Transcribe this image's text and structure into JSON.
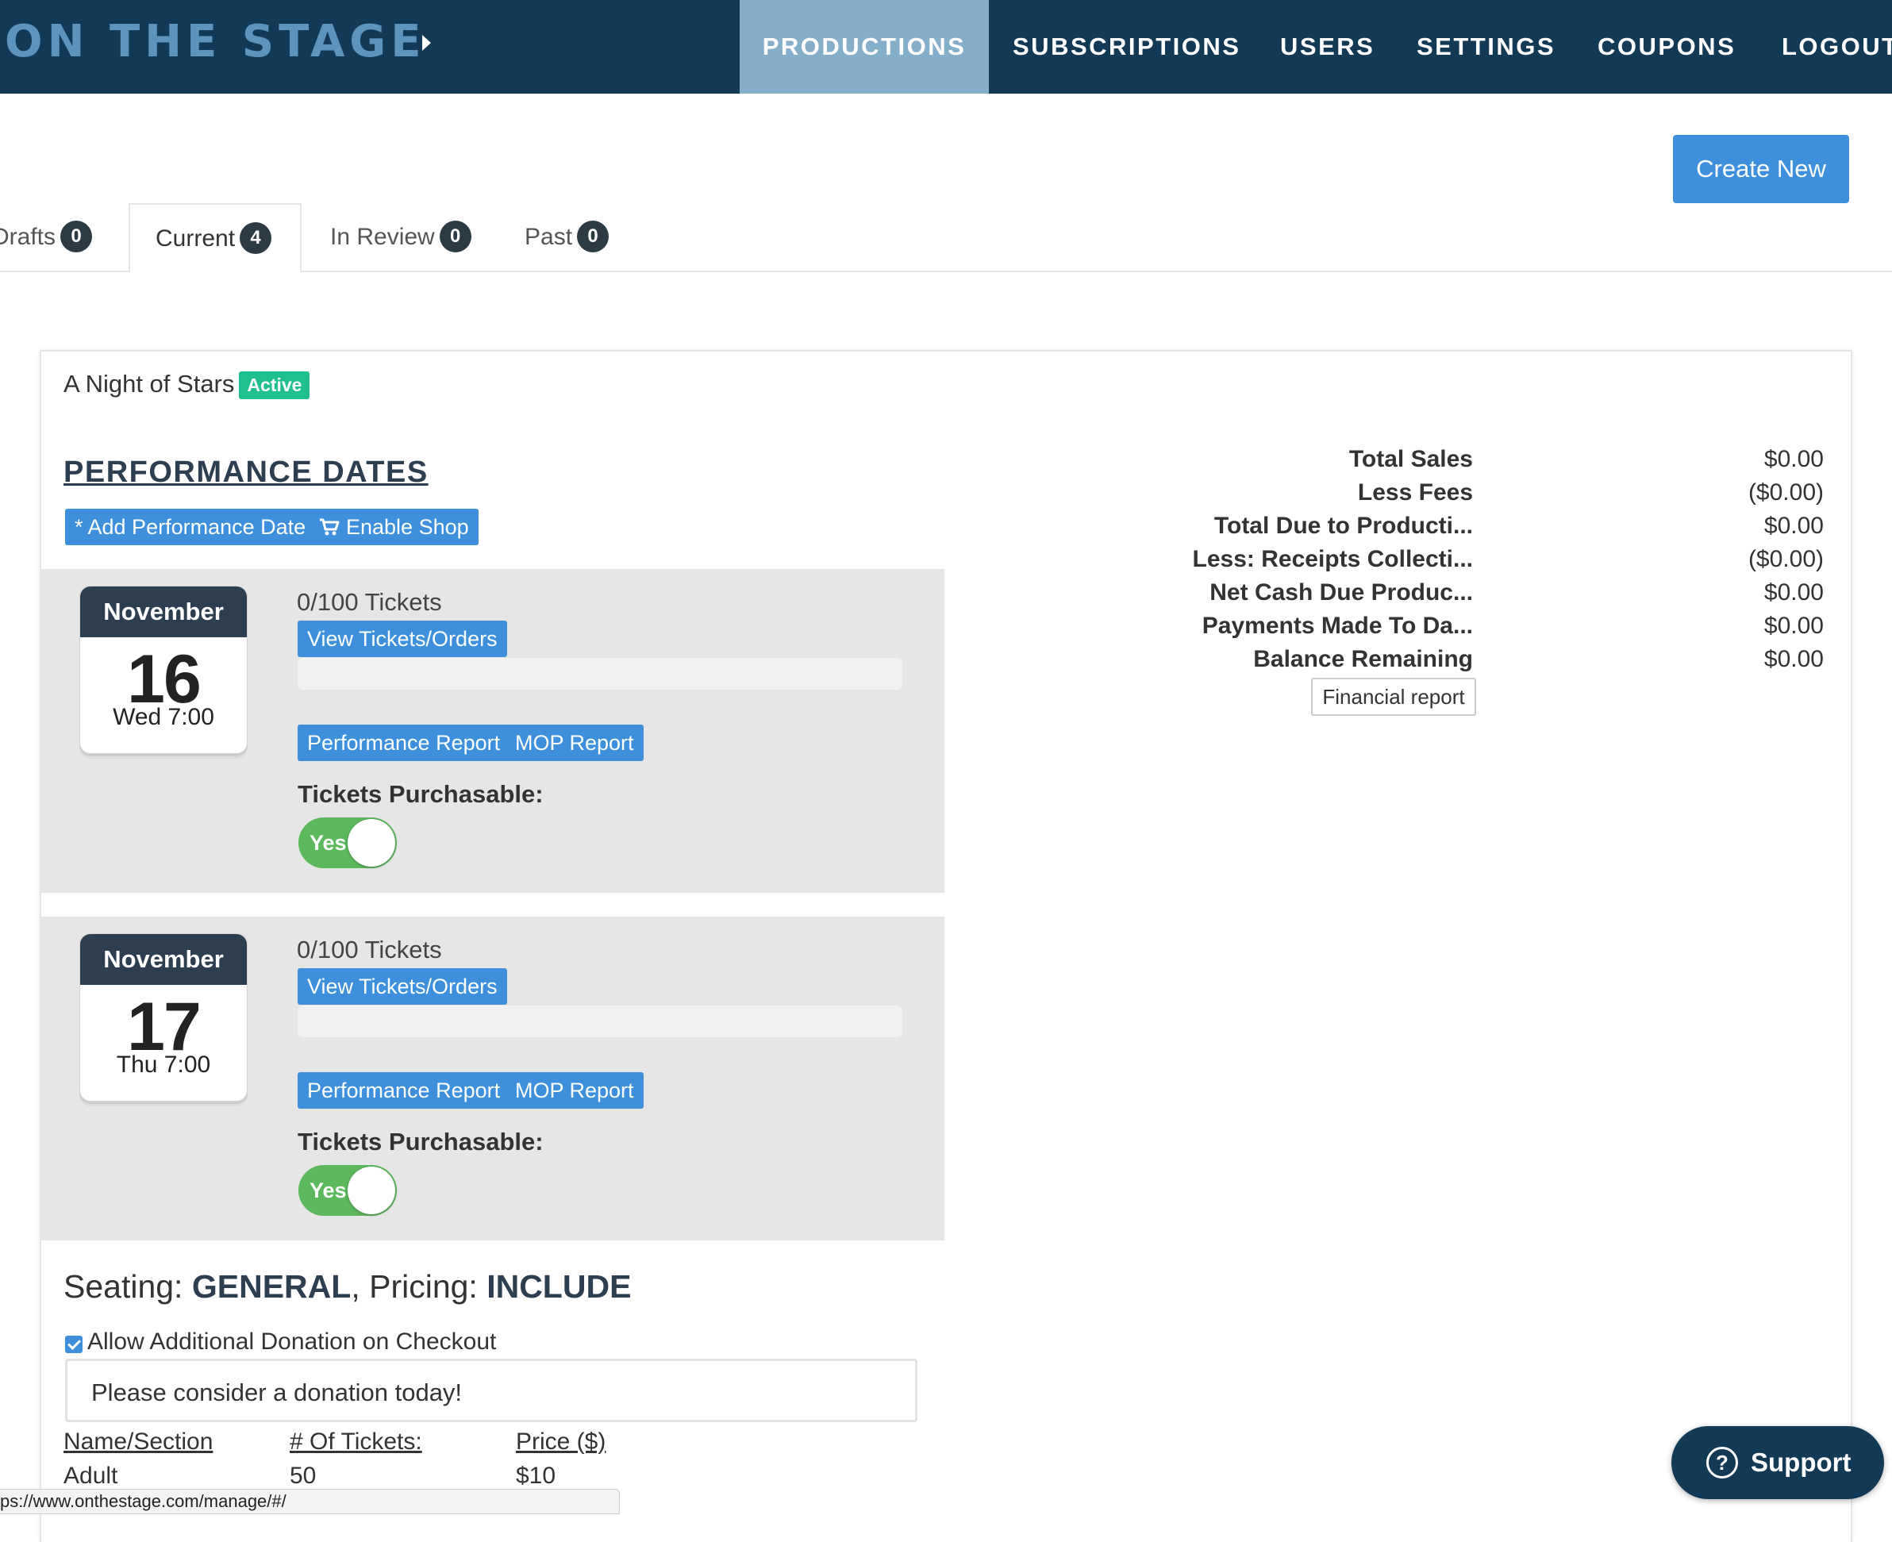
{
  "brand": {
    "name": "ON THE STAGE"
  },
  "nav": {
    "items": [
      {
        "label": "PRODUCTIONS",
        "active": true
      },
      {
        "label": "SUBSCRIPTIONS",
        "active": false
      },
      {
        "label": "USERS",
        "active": false
      },
      {
        "label": "SETTINGS",
        "active": false
      },
      {
        "label": "COUPONS",
        "active": false
      },
      {
        "label": "LOGOUT",
        "active": false
      }
    ]
  },
  "create_button": "Create New",
  "tabs": [
    {
      "label": "Drafts",
      "count": "0"
    },
    {
      "label": "Current",
      "count": "4",
      "active": true
    },
    {
      "label": "In Review",
      "count": "0"
    },
    {
      "label": "Past",
      "count": "0"
    }
  ],
  "production": {
    "title": "A Night of Stars",
    "status": "Active",
    "performance_heading": "PERFORMANCE DATES",
    "add_date_label": "* Add Performance Date",
    "enable_shop_label": "Enable Shop",
    "performances": [
      {
        "month": "November",
        "day": "16",
        "time": "Wed 7:00",
        "tickets": "0/100 Tickets",
        "sold_fraction": 0,
        "view_label": "View Tickets/Orders",
        "perf_report_label": "Performance Report",
        "mop_report_label": "MOP Report",
        "purchasable_label": "Tickets Purchasable:",
        "toggle_label": "Yes"
      },
      {
        "month": "November",
        "day": "17",
        "time": "Thu 7:00",
        "tickets": "0/100 Tickets",
        "sold_fraction": 0,
        "view_label": "View Tickets/Orders",
        "perf_report_label": "Performance Report",
        "mop_report_label": "MOP Report",
        "purchasable_label": "Tickets Purchasable:",
        "toggle_label": "Yes"
      }
    ],
    "financials": [
      {
        "label": "Total Sales",
        "value": "$0.00"
      },
      {
        "label": "Less Fees",
        "value": "($0.00)"
      },
      {
        "label": "Total Due to Producti...",
        "value": "$0.00"
      },
      {
        "label": "Less: Receipts Collecti...",
        "value": "($0.00)"
      },
      {
        "label": "Net Cash Due Produc...",
        "value": "$0.00"
      },
      {
        "label": "Payments Made To Da...",
        "value": "$0.00"
      },
      {
        "label": "Balance Remaining",
        "value": "$0.00"
      }
    ],
    "financial_report_label": "Financial report",
    "seating": {
      "prefix": "Seating: ",
      "type": "GENERAL",
      "mid": ", Pricing: ",
      "pricing": "INCLUDE"
    },
    "donation": {
      "checkbox_label": "Allow Additional Donation on Checkout",
      "checked": true,
      "message": "Please consider a donation today!"
    },
    "pricing_table": {
      "headers": [
        "Name/Section",
        "# Of Tickets:",
        "Price ($)"
      ],
      "rows": [
        [
          "Adult",
          "50",
          "$10"
        ]
      ]
    }
  },
  "status_url": "ps://www.onthestage.com/manage/#/",
  "support_label": "Support",
  "colors": {
    "nav_bg": "#123a57",
    "nav_active": "#85aecb",
    "primary": "#3e8fdc",
    "success": "#5cb85c",
    "active_badge": "#1fbf8f"
  }
}
